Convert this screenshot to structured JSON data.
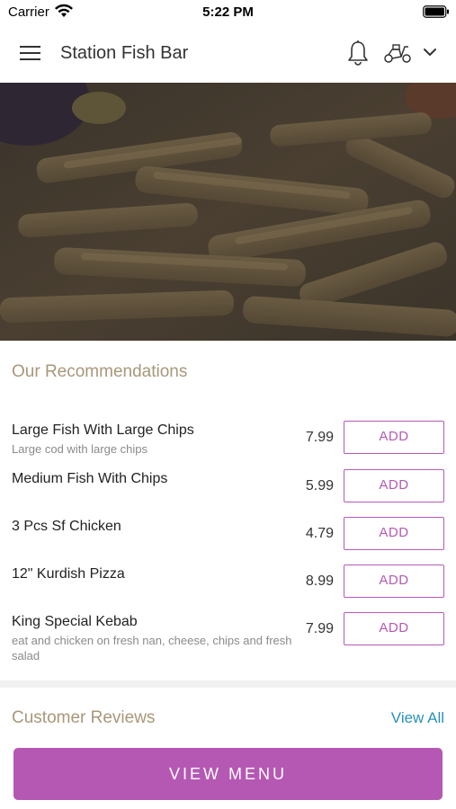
{
  "status_bar": {
    "carrier": "Carrier",
    "time": "5:22 PM"
  },
  "header": {
    "title": "Station Fish Bar"
  },
  "recommendations": {
    "title": "Our Recommendations",
    "items": [
      {
        "name": "Large Fish With Large Chips",
        "description": "Large cod with large chips",
        "price": "7.99",
        "add_label": "ADD"
      },
      {
        "name": "Medium Fish With Chips",
        "description": "",
        "price": "5.99",
        "add_label": "ADD"
      },
      {
        "name": "3 Pcs Sf Chicken",
        "description": "",
        "price": "4.79",
        "add_label": "ADD"
      },
      {
        "name": "12\" Kurdish Pizza",
        "description": "",
        "price": "8.99",
        "add_label": "ADD"
      },
      {
        "name": "King Special Kebab",
        "description": "eat and chicken on fresh nan, cheese, chips and fresh salad",
        "price": "7.99",
        "add_label": "ADD"
      }
    ]
  },
  "reviews": {
    "title": "Customer Reviews",
    "view_all": "View All"
  },
  "footer": {
    "view_menu_label": "VIEW MENU"
  },
  "colors": {
    "accent": "#b558b4",
    "section_title": "#a8977a",
    "link": "#2b8fbf"
  },
  "icons": [
    "wifi-icon",
    "battery-icon",
    "menu-icon",
    "bell-icon",
    "scooter-icon",
    "chevron-down-icon"
  ]
}
